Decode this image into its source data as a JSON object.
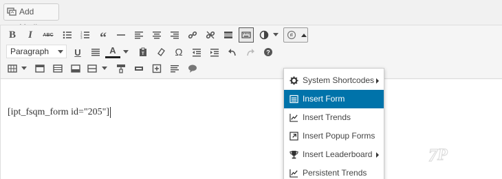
{
  "media": {
    "add_media_label": "Add Media"
  },
  "toolbar": {
    "format_select_value": "Paragraph"
  },
  "editor": {
    "content_text": "[ipt_fsqm_form id=\"205\"]"
  },
  "dropdown": {
    "items": [
      {
        "label": "System Shortcodes",
        "icon": "gear-icon",
        "has_submenu": true
      },
      {
        "label": "Insert Form",
        "icon": "form-icon",
        "selected": true
      },
      {
        "label": "Insert Trends",
        "icon": "trend-chart-icon"
      },
      {
        "label": "Insert Popup Forms",
        "icon": "popup-icon"
      },
      {
        "label": "Insert Leaderboard",
        "icon": "trophy-icon",
        "has_submenu": true
      },
      {
        "label": "Persistent Trends",
        "icon": "trend-chart-icon"
      }
    ]
  },
  "colors": {
    "selected_bg": "#0073aa",
    "selected_text": "#ffffff"
  }
}
